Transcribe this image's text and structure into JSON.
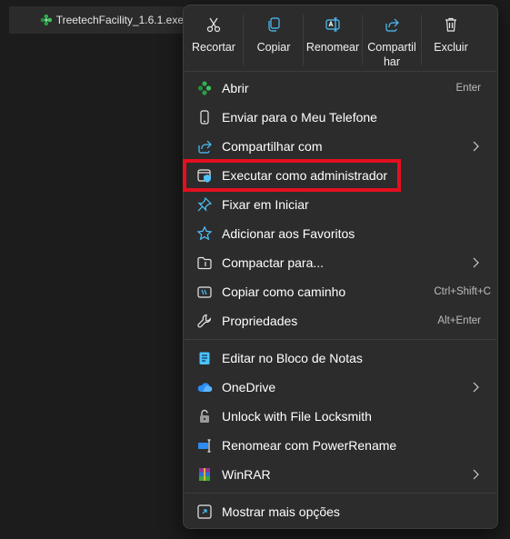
{
  "file": {
    "name": "TreetechFacility_1.6.1.exe"
  },
  "toolbar": {
    "cut": "Recortar",
    "copy": "Copiar",
    "rename": "Renomear",
    "share_line1": "Compartil",
    "share_line2": "har",
    "delete": "Excluir"
  },
  "menu": {
    "open": {
      "label": "Abrir",
      "shortcut": "Enter"
    },
    "send_phone": {
      "label": "Enviar para o Meu Telefone"
    },
    "share_with": {
      "label": "Compartilhar com"
    },
    "run_admin": {
      "label": "Executar como administrador"
    },
    "pin_start": {
      "label": "Fixar em Iniciar"
    },
    "add_favorites": {
      "label": "Adicionar aos Favoritos"
    },
    "compress": {
      "label": "Compactar para..."
    },
    "copy_path": {
      "label": "Copiar como caminho",
      "shortcut": "Ctrl+Shift+C"
    },
    "properties": {
      "label": "Propriedades",
      "shortcut": "Alt+Enter"
    },
    "notepad": {
      "label": "Editar no Bloco de Notas"
    },
    "onedrive": {
      "label": "OneDrive"
    },
    "locksmith": {
      "label": "Unlock with File Locksmith"
    },
    "powerrename": {
      "label": "Renomear com PowerRename"
    },
    "winrar": {
      "label": "WinRAR"
    },
    "more_options": {
      "label": "Mostrar mais opções"
    }
  },
  "colors": {
    "highlight": "#e3101f",
    "menu_bg": "#2c2c2c",
    "accent_blue": "#4cc2ff"
  }
}
